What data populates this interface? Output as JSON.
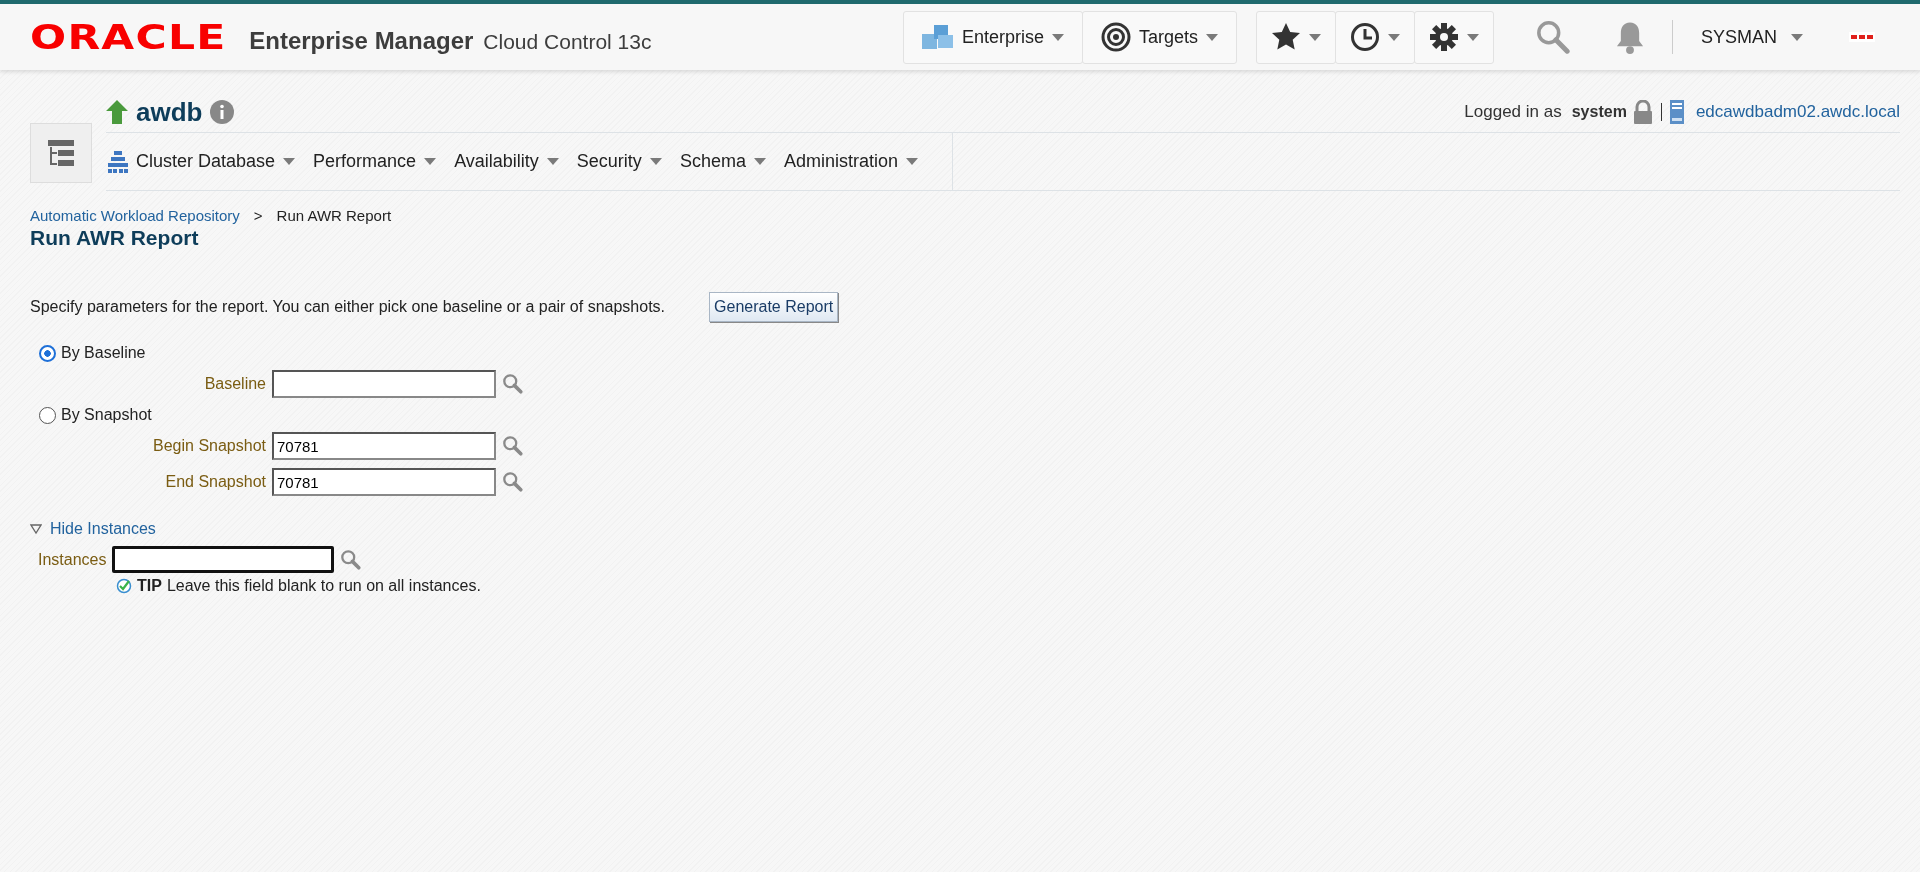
{
  "header": {
    "brand": "ORACLE",
    "product": "Enterprise Manager",
    "edition": "Cloud Control 13c",
    "menus": [
      {
        "kind": "enterprise",
        "label": "Enterprise"
      },
      {
        "kind": "targets",
        "label": "Targets"
      }
    ],
    "tools": [
      {
        "kind": "favorites"
      },
      {
        "kind": "history"
      },
      {
        "kind": "setup"
      }
    ],
    "user": "SYSMAN"
  },
  "target": {
    "name": "awdb",
    "nav": [
      {
        "label": "Cluster Database",
        "icon": true
      },
      {
        "label": "Performance",
        "icon": false
      },
      {
        "label": "Availability",
        "icon": false
      },
      {
        "label": "Security",
        "icon": false
      },
      {
        "label": "Schema",
        "icon": false
      },
      {
        "label": "Administration",
        "icon": false
      }
    ],
    "login_prefix": "Logged in as",
    "login_user": "system",
    "host": "edcawdbadm02.awdc.local"
  },
  "breadcrumbs": [
    {
      "label": "Automatic Workload Repository",
      "link": true
    },
    {
      "label": "Run AWR Report",
      "link": false
    }
  ],
  "breadcrumb_separator": ">",
  "title": "Run AWR Report",
  "description": "Specify parameters for the report. You can either pick one baseline or a pair of snapshots.",
  "generate_button": "Generate Report",
  "options": [
    {
      "label": "By Baseline",
      "selected": true,
      "fields": [
        {
          "label": "Baseline"
        }
      ]
    },
    {
      "label": "By Snapshot",
      "selected": false,
      "fields": [
        {
          "label": "Begin Snapshot",
          "value": "70781"
        },
        {
          "label": "End Snapshot",
          "value": "70781"
        }
      ]
    }
  ],
  "instances": {
    "toggle": "Hide Instances",
    "expanded": true,
    "label": "Instances",
    "focused": true,
    "tip_label": "TIP",
    "tip": "Leave this field blank to run on all instances."
  }
}
